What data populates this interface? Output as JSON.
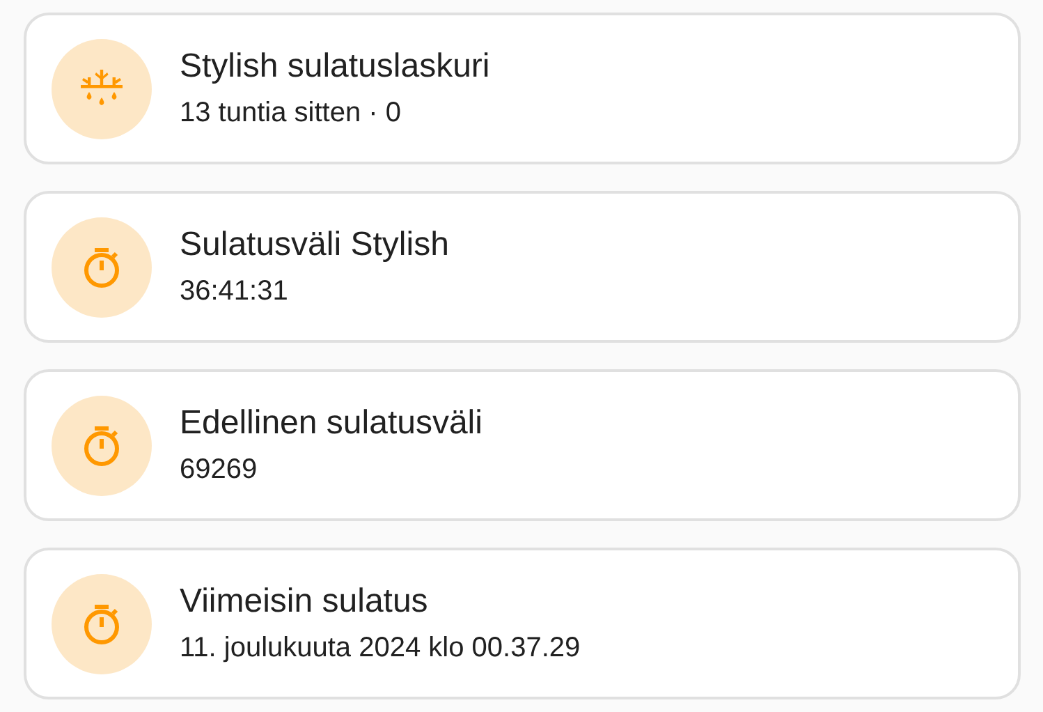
{
  "cards": [
    {
      "kind": "defrost",
      "title": "Stylish sulatuslaskuri",
      "subtitle": "13 tuntia sitten · 0"
    },
    {
      "kind": "timer",
      "title": "Sulatusväli Stylish",
      "subtitle": "36:41:31"
    },
    {
      "kind": "timer",
      "title": "Edellinen sulatusväli",
      "subtitle": "69269"
    },
    {
      "kind": "timer",
      "title": "Viimeisin sulatus",
      "subtitle": "11. joulukuuta 2024 klo 00.37.29"
    }
  ]
}
